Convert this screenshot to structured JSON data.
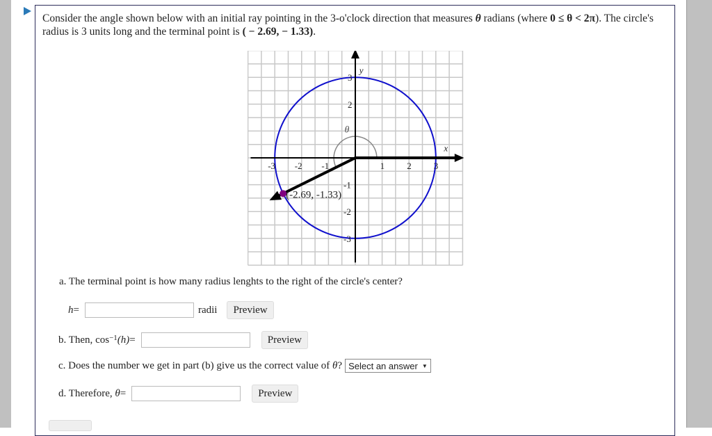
{
  "prompt": {
    "line1_a": "Consider the angle shown below with an initial ray pointing in the 3-o'clock direction that measures ",
    "theta": "θ",
    "line1_b": " radians (where ",
    "range": "0 ≤ θ < 2π",
    "line1_c": "). The circle's",
    "line2_a": "radius is 3 units long and the terminal point is ",
    "terminal_point": "( − 2.69,  − 1.33)",
    "line2_b": "."
  },
  "graph": {
    "x_axis_label": "x",
    "y_axis_label": "y",
    "angle_label": "θ",
    "x_ticks": [
      "-3",
      "-2",
      "-1",
      "1",
      "2",
      "3"
    ],
    "y_ticks": [
      "3",
      "2",
      "-1",
      "-2",
      "-3"
    ],
    "point_label": "(-2.69, -1.33)",
    "radius": 3,
    "point": [
      -2.69,
      -1.33
    ],
    "range": [
      -4,
      4
    ],
    "grid_step": 0.5,
    "colors": {
      "circle": "#1010cc",
      "point": "#800080",
      "grid": "#c8c8c8",
      "arc": "#888888"
    }
  },
  "part_a": {
    "question": "a. The terminal point is how many radius lenghts to the right of the circle's center?",
    "var_label": "h",
    "equals": " =",
    "input_value": "",
    "unit": "radii",
    "preview_label": "Preview"
  },
  "part_b": {
    "prefix": "b. Then, ",
    "func": "cos",
    "sup": "−1",
    "arg": "(h)",
    "equals": " =",
    "input_value": "",
    "preview_label": "Preview"
  },
  "part_c": {
    "question_a": "c. Does the number we get in part (b) give us the correct value of ",
    "theta": "θ",
    "question_b": "?",
    "select_value": "Select an answer"
  },
  "part_d": {
    "prefix": "d. Therefore, ",
    "theta": "θ",
    "equals": " =",
    "input_value": "",
    "preview_label": "Preview"
  }
}
